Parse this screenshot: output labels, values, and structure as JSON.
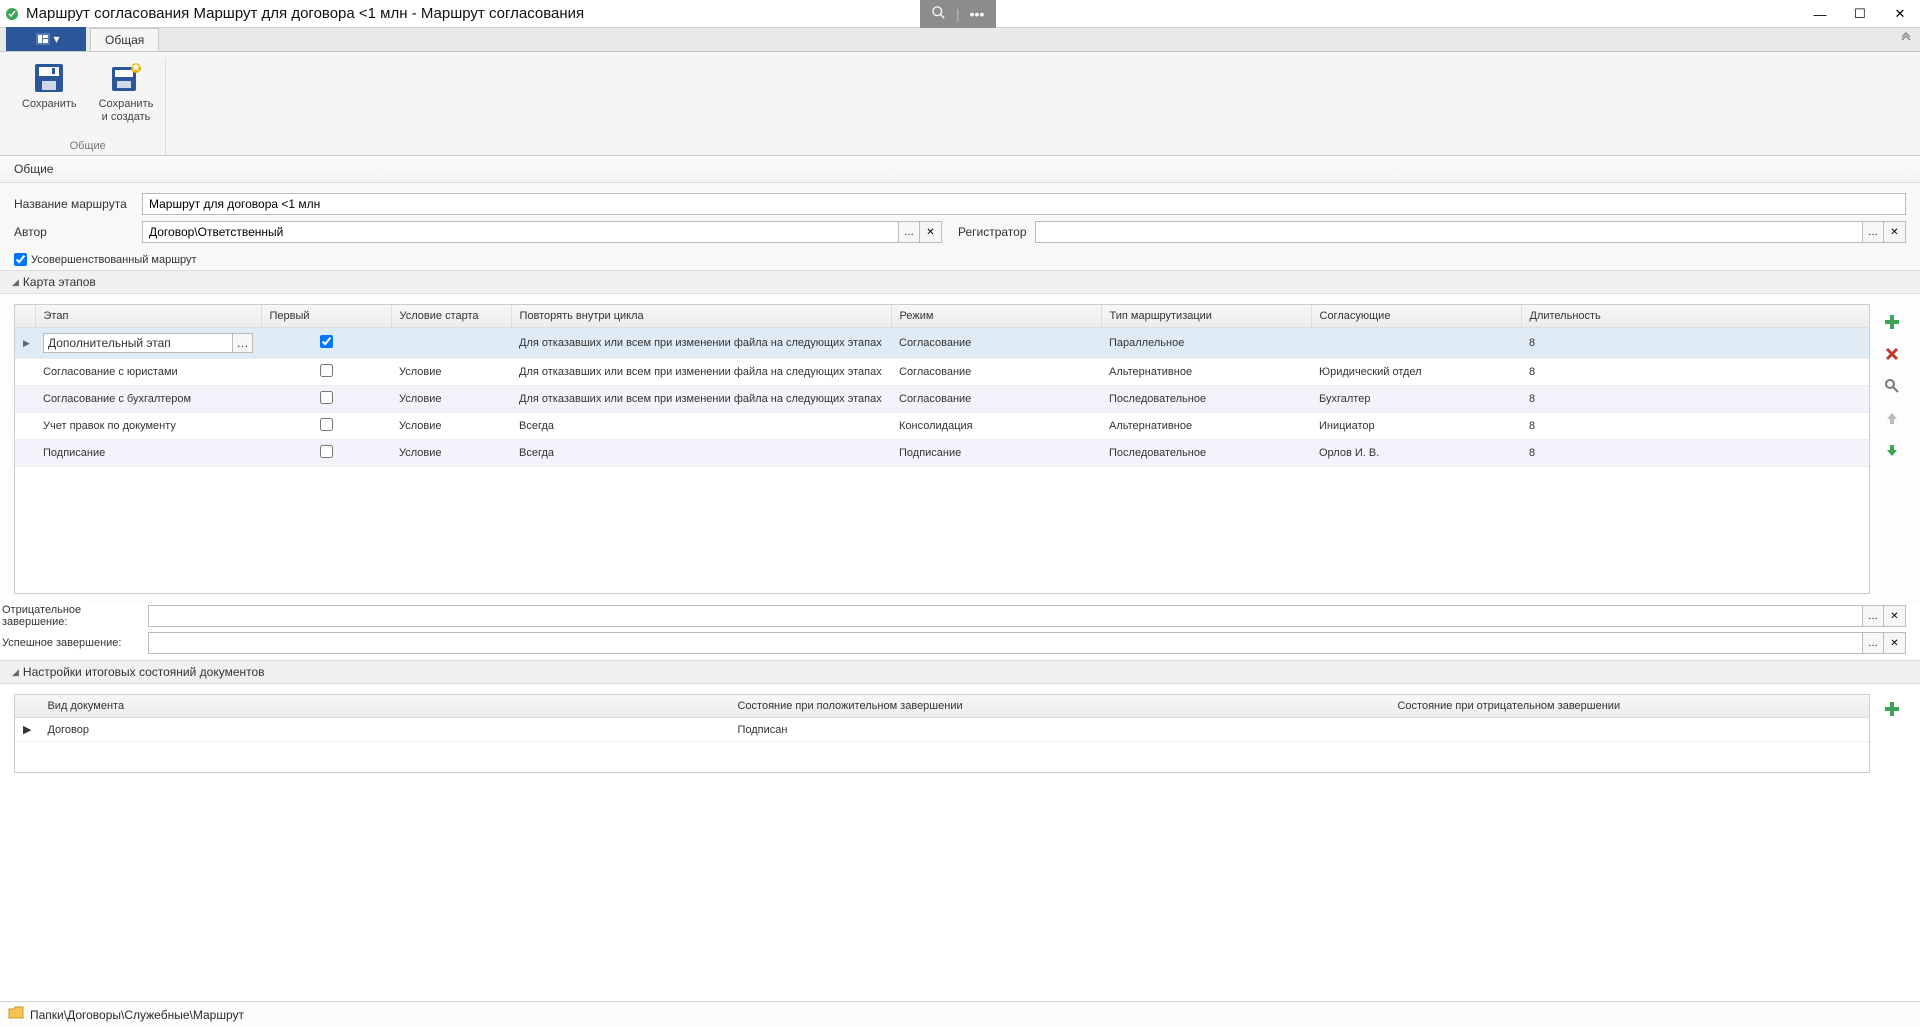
{
  "window": {
    "title": "Маршрут согласования Маршрут для договора <1 млн - Маршрут согласования"
  },
  "tabs": {
    "app_button_label": "",
    "general": "Общая"
  },
  "ribbon": {
    "save": "Сохранить",
    "save_and_new": "Сохранить\nи создать",
    "group_label": "Общие"
  },
  "section": {
    "general": "Общие"
  },
  "form": {
    "route_name_label": "Название маршрута",
    "route_name_value": "Маршрут для договора <1 млн",
    "author_label": "Автор",
    "author_value": "Договор\\Ответственный",
    "registrar_label": "Регистратор",
    "registrar_value": "",
    "advanced_checkbox_label": "Усовершенствованный маршрут",
    "advanced_checked": true
  },
  "stage_map": {
    "caption": "Карта этапов",
    "columns": {
      "stage": "Этап",
      "first": "Первый",
      "start_condition": "Условие старта",
      "repeat": "Повторять внутри цикла",
      "mode": "Режим",
      "routing_type": "Тип маршрутизации",
      "approvers": "Согласующие",
      "duration": "Длительность"
    },
    "rows": [
      {
        "selected": true,
        "stage": "Дополнительный этап",
        "first": true,
        "start_condition": "",
        "repeat": "Для отказавших или всем при изменении файла на следующих этапах",
        "mode": "Согласование",
        "routing_type": "Параллельное",
        "approvers": "",
        "duration": "8"
      },
      {
        "selected": false,
        "stage": "Согласование с юристами",
        "first": false,
        "start_condition": "Условие",
        "repeat": "Для отказавших или всем при изменении файла на следующих этапах",
        "mode": "Согласование",
        "routing_type": "Альтернативное",
        "approvers": "Юридический отдел",
        "duration": "8"
      },
      {
        "selected": false,
        "stage": "Согласование с бухгалтером",
        "first": false,
        "start_condition": "Условие",
        "repeat": "Для отказавших или всем при изменении файла на следующих этапах",
        "mode": "Согласование",
        "routing_type": "Последовательное",
        "approvers": "Бухгалтер",
        "duration": "8"
      },
      {
        "selected": false,
        "stage": "Учет правок по документу",
        "first": false,
        "start_condition": "Условие",
        "repeat": "Всегда",
        "mode": "Консолидация",
        "routing_type": "Альтернативное",
        "approvers": "Инициатор",
        "duration": "8"
      },
      {
        "selected": false,
        "stage": "Подписание",
        "first": false,
        "start_condition": "Условие",
        "repeat": "Всегда",
        "mode": "Подписание",
        "routing_type": "Последовательное",
        "approvers": "Орлов И. В.",
        "duration": "8"
      }
    ]
  },
  "completion": {
    "negative_label": "Отрицательное завершение:",
    "negative_value": "",
    "success_label": "Успешное завершение:",
    "success_value": ""
  },
  "doc_states": {
    "caption": "Настройки итоговых состояний документов",
    "columns": {
      "doc_type": "Вид документа",
      "positive_state": "Состояние при положительном завершении",
      "negative_state": "Состояние при отрицательном завершении"
    },
    "rows": [
      {
        "doc_type": "Договор",
        "positive_state": "Подписан",
        "negative_state": ""
      }
    ]
  },
  "breadcrumb": "Папки\\Договоры\\Служебные\\Маршрут",
  "glyphs": {
    "ellipsis": "…",
    "close_x": "✕",
    "caret": "▾"
  }
}
